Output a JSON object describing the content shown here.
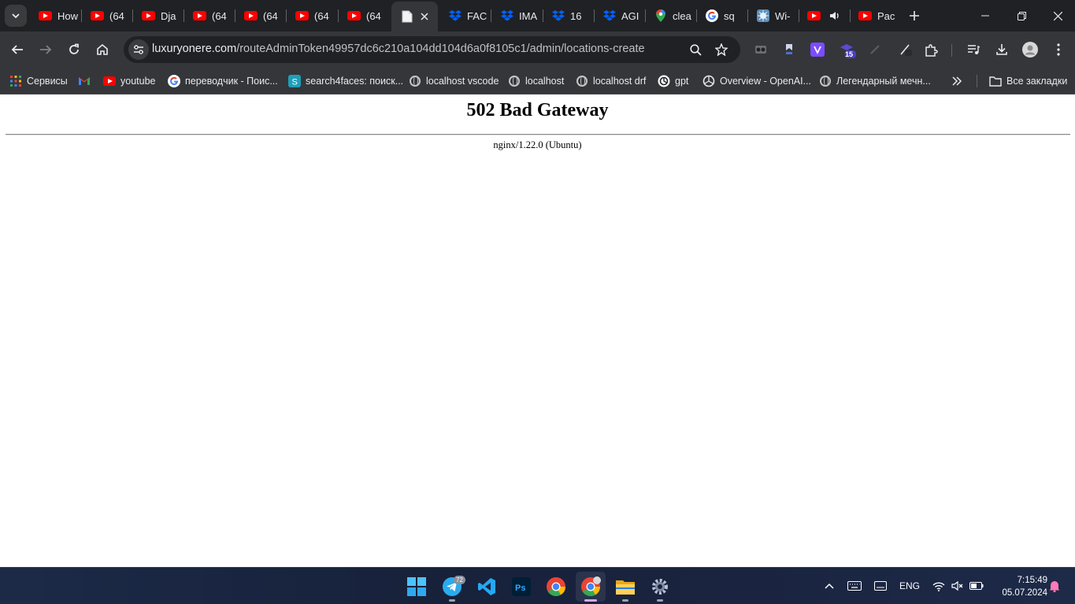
{
  "browser": {
    "tabs": [
      {
        "favicon": "youtube-icon",
        "title": "How"
      },
      {
        "favicon": "youtube-icon",
        "title": "(64"
      },
      {
        "favicon": "youtube-icon",
        "title": "Dja"
      },
      {
        "favicon": "youtube-icon",
        "title": "(64"
      },
      {
        "favicon": "youtube-icon",
        "title": "(64"
      },
      {
        "favicon": "youtube-icon",
        "title": "(64"
      },
      {
        "favicon": "youtube-icon",
        "title": "(64"
      },
      {
        "favicon": "blank-page-icon",
        "title": "",
        "active": true
      },
      {
        "favicon": "dropbox-icon",
        "title": "FAC"
      },
      {
        "favicon": "dropbox-icon",
        "title": "IMA"
      },
      {
        "favicon": "dropbox-icon",
        "title": "16"
      },
      {
        "favicon": "dropbox-icon",
        "title": "AGI"
      },
      {
        "favicon": "google-maps-icon",
        "title": "clea"
      },
      {
        "favicon": "google-icon",
        "title": "sq"
      },
      {
        "favicon": "wifi-site-icon",
        "title": "Wi-"
      },
      {
        "favicon": "youtube-icon",
        "title": ""
      },
      {
        "favicon": "youtube-icon",
        "title": "Pac"
      }
    ],
    "address": {
      "host": "luxuryonere.com",
      "path": "/routeAdminToken49957dc6c210a104dd104d6a0f8105c1/admin/locations-create"
    },
    "extension_badge": "15",
    "bookmarks": [
      {
        "icon": "apps-grid-icon",
        "label": "Сервисы"
      },
      {
        "icon": "gmail-icon",
        "label": ""
      },
      {
        "icon": "youtube-icon",
        "label": "youtube"
      },
      {
        "icon": "google-icon",
        "label": "переводчик - Поис..."
      },
      {
        "icon": "search4faces-icon",
        "label": "search4faces: поиск..."
      },
      {
        "icon": "globe-icon",
        "label": "localhost vscode"
      },
      {
        "icon": "globe-icon",
        "label": "localhost"
      },
      {
        "icon": "globe-icon",
        "label": "localhost drf"
      },
      {
        "icon": "openai-icon",
        "label": "gpt"
      },
      {
        "icon": "openai-icon",
        "label": "Overview - OpenAI..."
      },
      {
        "icon": "globe-icon",
        "label": "Легендарный мечн..."
      }
    ],
    "all_bookmarks_label": "Все закладки"
  },
  "page": {
    "heading": "502 Bad Gateway",
    "server": "nginx/1.22.0 (Ubuntu)"
  },
  "taskbar": {
    "telegram_badge": "72",
    "language": "ENG",
    "time": "7:15:49",
    "date": "05.07.2024"
  },
  "colors": {
    "tab_strip": "#202124",
    "toolbar": "#35363a",
    "taskbar": "#1a2440",
    "youtube_red": "#ff0000",
    "dropbox_blue": "#0061fe"
  }
}
